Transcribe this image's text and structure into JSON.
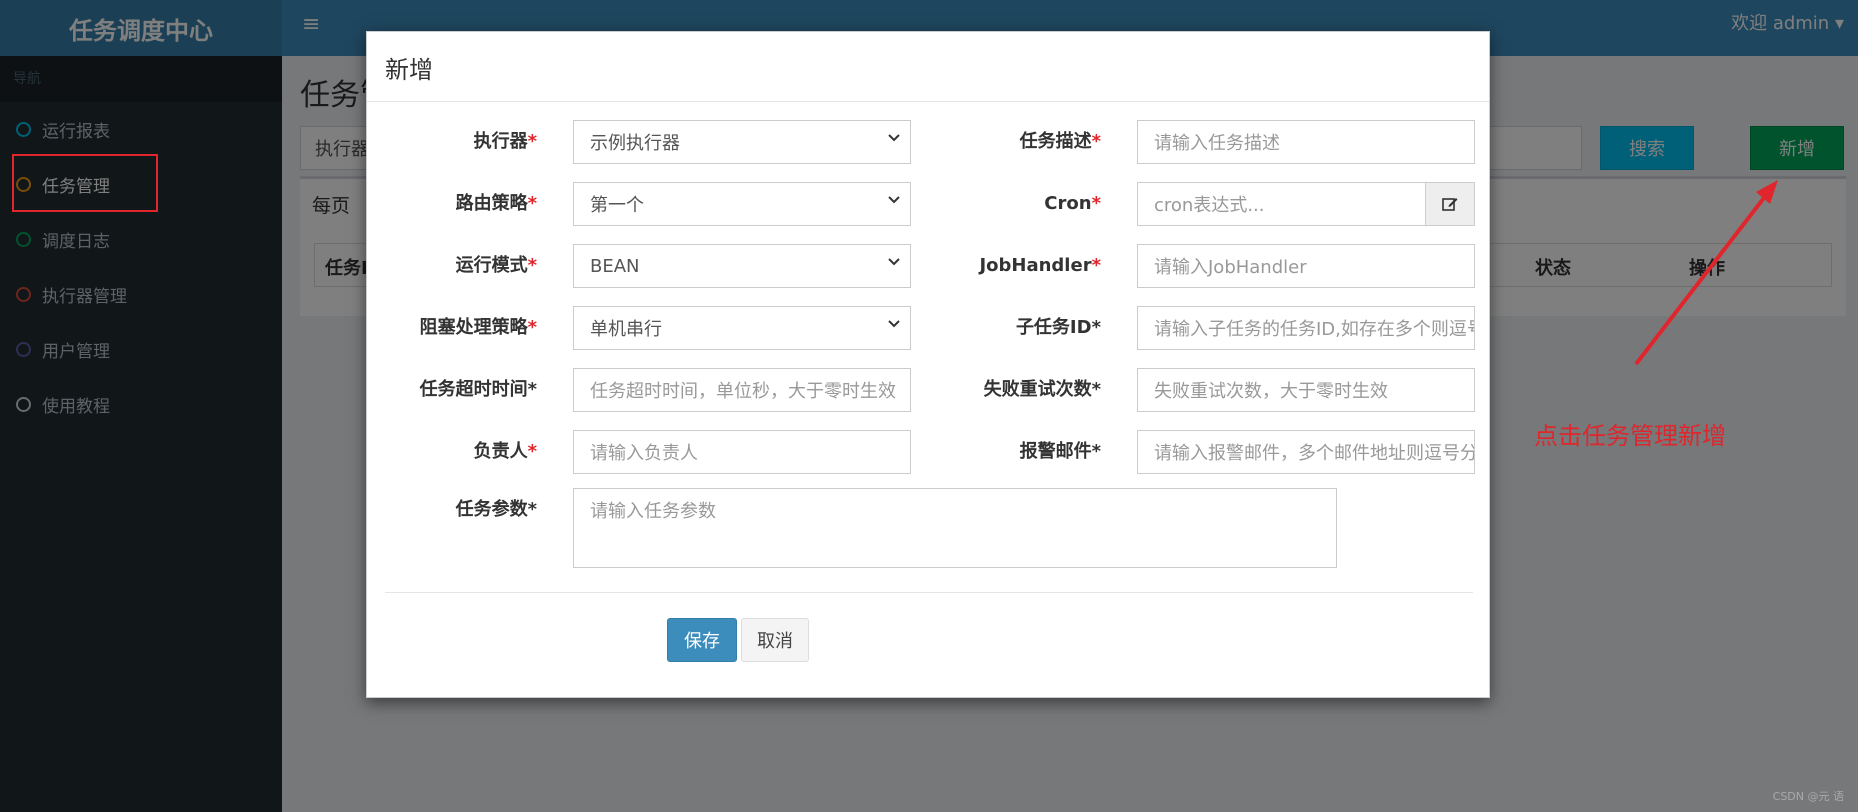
{
  "app": {
    "title": "任务调度中心",
    "user": "欢迎 admin"
  },
  "sidebar": {
    "header": "导航",
    "items": [
      {
        "label": "运行报表",
        "color": "#00c0ef"
      },
      {
        "label": "任务管理",
        "color": "#f39c12"
      },
      {
        "label": "调度日志",
        "color": "#00a65a"
      },
      {
        "label": "执行器管理",
        "color": "#dd4b39"
      },
      {
        "label": "用户管理",
        "color": "#605ca8"
      },
      {
        "label": "使用教程",
        "color": "#d2d6de"
      }
    ]
  },
  "page": {
    "title": "任务管理",
    "filter_label": "执行器",
    "search_button": "搜索",
    "add_button": "新增",
    "per_page_label": "每页",
    "columns": {
      "id": "任务ID",
      "status": "状态",
      "actions": "操作"
    }
  },
  "modal": {
    "title": "新增",
    "fields": {
      "executor": {
        "label": "执行器",
        "value": "示例执行器"
      },
      "route": {
        "label": "路由策略",
        "value": "第一个"
      },
      "mode": {
        "label": "运行模式",
        "value": "BEAN"
      },
      "block": {
        "label": "阻塞处理策略",
        "value": "单机串行"
      },
      "timeout": {
        "label": "任务超时时间*",
        "placeholder": "任务超时时间，单位秒，大于零时生效"
      },
      "author": {
        "label": "负责人",
        "placeholder": "请输入负责人"
      },
      "params": {
        "label": "任务参数*",
        "placeholder": "请输入任务参数"
      },
      "desc": {
        "label": "任务描述",
        "placeholder": "请输入任务描述"
      },
      "cron": {
        "label": "Cron",
        "placeholder": "cron表达式..."
      },
      "handler": {
        "label": "JobHandler",
        "placeholder": "请输入JobHandler"
      },
      "child": {
        "label": "子任务ID*",
        "placeholder": "请输入子任务的任务ID,如存在多个则逗号分隔"
      },
      "retry": {
        "label": "失败重试次数*",
        "placeholder": "失败重试次数，大于零时生效"
      },
      "alarm": {
        "label": "报警邮件*",
        "placeholder": "请输入报警邮件，多个邮件地址则逗号分隔"
      }
    },
    "save": "保存",
    "cancel": "取消"
  },
  "annotation": {
    "text": "点击任务管理新增"
  },
  "watermark": "CSDN @元 语"
}
